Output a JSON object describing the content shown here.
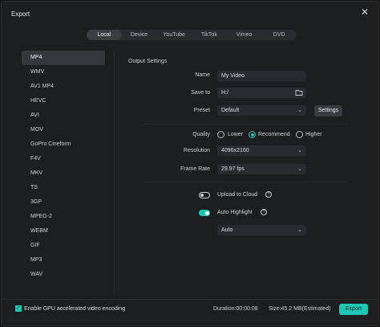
{
  "window": {
    "title": "Export",
    "close_icon": "close-icon"
  },
  "tabs": [
    {
      "label": "Local",
      "active": true
    },
    {
      "label": "Device",
      "active": false
    },
    {
      "label": "YouTube",
      "active": false
    },
    {
      "label": "TikTok",
      "active": false
    },
    {
      "label": "Vimeo",
      "active": false
    },
    {
      "label": "DVD",
      "active": false
    }
  ],
  "formats": [
    "MP4",
    "WMV",
    "AV1 MP4",
    "HEVC",
    "AVI",
    "MOV",
    "GoPro Cineform",
    "F4V",
    "MKV",
    "TS",
    "3GP",
    "MPEG-2",
    "WEBM",
    "GIF",
    "MP3",
    "WAV"
  ],
  "selected_format": "MP4",
  "output": {
    "section_title": "Output Settings",
    "name_label": "Name",
    "name_value": "My Video",
    "saveto_label": "Save to",
    "saveto_value": "H:/",
    "preset_label": "Preset",
    "preset_value": "Default",
    "settings_button": "Settings",
    "quality_label": "Quality",
    "quality_options": [
      "Lower",
      "Recommend",
      "Higher"
    ],
    "quality_selected": "Recommend",
    "resolution_label": "Resolution",
    "resolution_value": "4096x2160",
    "framerate_label": "Frame Rate",
    "framerate_value": "29.97 fps",
    "upload_label": "Upload to Cloud",
    "upload_enabled": false,
    "highlight_label": "Auto Highlight",
    "highlight_enabled": true,
    "highlight_mode": "Auto"
  },
  "footer": {
    "gpu_label": "Enable GPU accelerated video encoding",
    "gpu_checked": true,
    "duration": "Duration:00:00:08",
    "size": "Size:45.2 MB(Estimated)",
    "export_button": "Export"
  },
  "colors": {
    "accent": "#1ec7b4",
    "background": "#1d1e20",
    "field": "#2a2b2e"
  }
}
